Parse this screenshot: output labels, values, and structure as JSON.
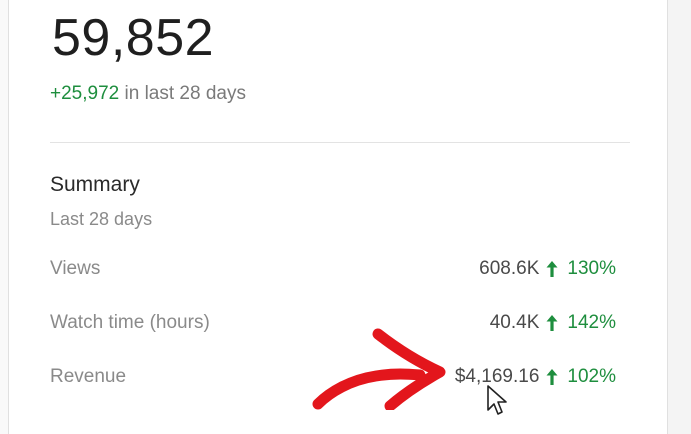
{
  "stat": {
    "total": "59,852",
    "delta_value": "+25,972",
    "delta_suffix": " in last 28 days"
  },
  "summary": {
    "title": "Summary",
    "subtitle": "Last 28 days",
    "metrics": [
      {
        "label": "Views",
        "value": "608.6K",
        "change": "130%"
      },
      {
        "label": "Watch time (hours)",
        "value": "40.4K",
        "change": "142%"
      },
      {
        "label": "Revenue",
        "value": "$4,169.16",
        "change": "102%"
      }
    ]
  },
  "colors": {
    "positive": "#1e8e3e",
    "annotation": "#e3161c"
  },
  "icons": {
    "change_indicator": "arrow-up-icon",
    "annotation": "red-hand-drawn-arrow",
    "pointer": "mouse-cursor-icon"
  }
}
